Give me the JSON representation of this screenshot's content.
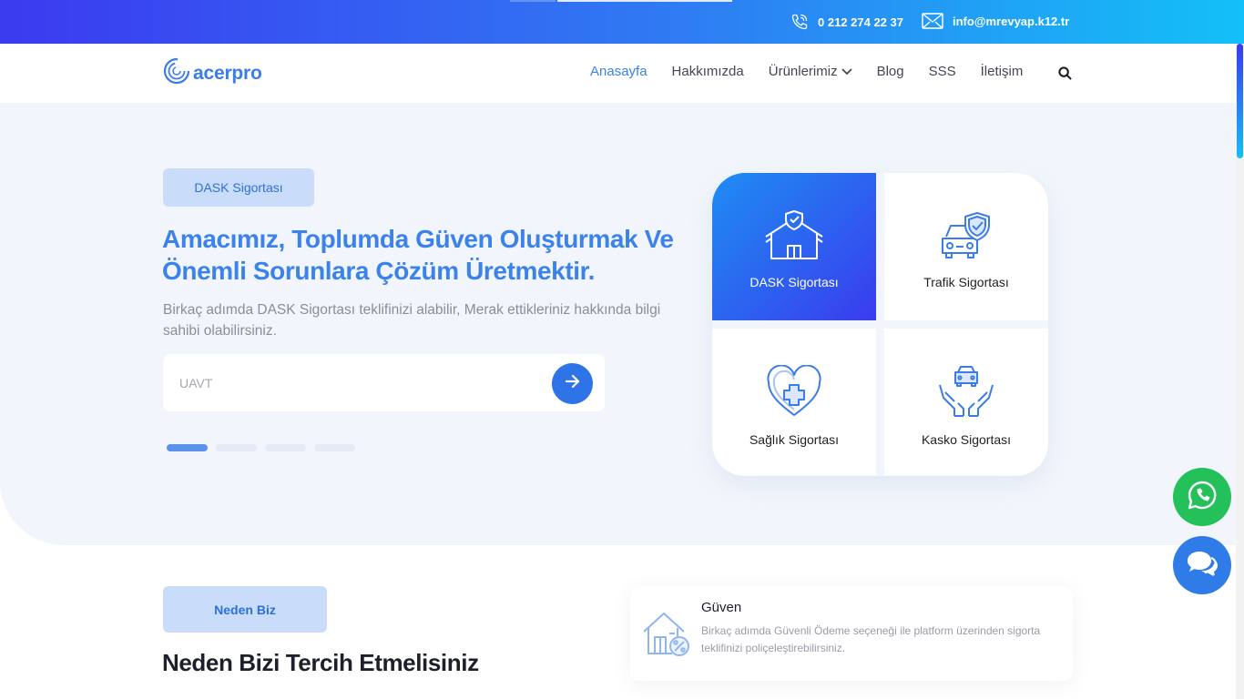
{
  "topbar": {
    "phone": "0 212 274 22 37",
    "email": "info@mrevyap.k12.tr"
  },
  "nav": {
    "logo_text": "acerpro",
    "items": [
      {
        "label": "Anasayfa",
        "active": true
      },
      {
        "label": "Hakkımızda"
      },
      {
        "label": "Ürünlerimiz",
        "dropdown": true
      },
      {
        "label": "Blog"
      },
      {
        "label": "SSS"
      },
      {
        "label": "İletişim"
      }
    ]
  },
  "hero": {
    "pill": "DASK Sigortası",
    "title": "Amacımız, Toplumda Güven Oluşturmak Ve Önemli Sorunlara Çözüm Üretmektir.",
    "description": "Birkaç adımda DASK Sigortası teklifinizi alabilir, Merak ettikleriniz hakkında bilgi sahibi olabilirsiniz.",
    "input_placeholder": "UAVT",
    "active_slide": 1,
    "slide_count": 4
  },
  "services": [
    {
      "label": "DASK Sigortası",
      "icon": "house-shield-icon"
    },
    {
      "label": "Trafik Sigortası",
      "icon": "car-shield-icon"
    },
    {
      "label": "Sağlık Sigortası",
      "icon": "heart-plus-icon"
    },
    {
      "label": "Kasko Sigortası",
      "icon": "hands-car-icon"
    }
  ],
  "why": {
    "pill": "Neden Biz",
    "title": "Neden Bizi Tercih Etmelisiniz",
    "feature": {
      "title": "Güven",
      "description": "Birkaç adımda Güvenli Ödeme seçeneği ile platform üzerinden sigorta teklifinizi poliçeleştirebilirsiniz."
    }
  },
  "colors": {
    "accent": "#3b82ea",
    "gradient_start": "#3b3af0",
    "gradient_end": "#13c0f7",
    "whatsapp": "#24c15a"
  }
}
